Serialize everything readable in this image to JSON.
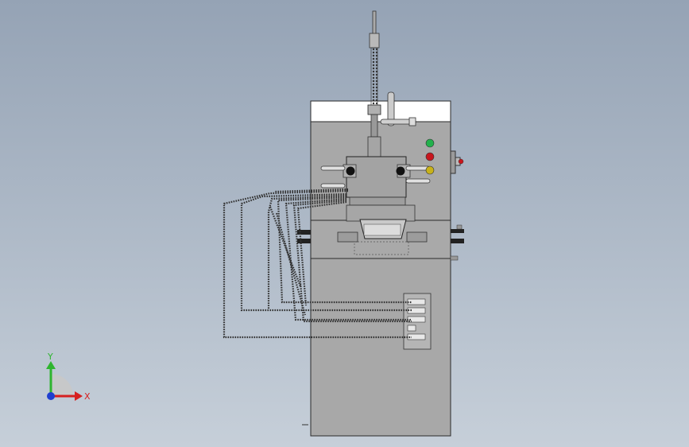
{
  "viewport": {
    "background_top": "#95a3b5",
    "background_bottom": "#c6cfd9"
  },
  "model": {
    "body_color": "#a8a8a8",
    "top_cap_color": "#ffffff",
    "outline_color": "#2a2a2a",
    "cable_color": "#3a3a3a"
  },
  "indicator_lights": [
    {
      "name": "green-light",
      "color": "#22b14c"
    },
    {
      "name": "red-light",
      "color": "#c8161d"
    },
    {
      "name": "yellow-light",
      "color": "#c8b21a"
    }
  ],
  "triad": {
    "y_label": "Y",
    "x_label": "X",
    "y_color": "#2fb52f",
    "x_color": "#d62020",
    "z_color": "#1f3fd0"
  }
}
